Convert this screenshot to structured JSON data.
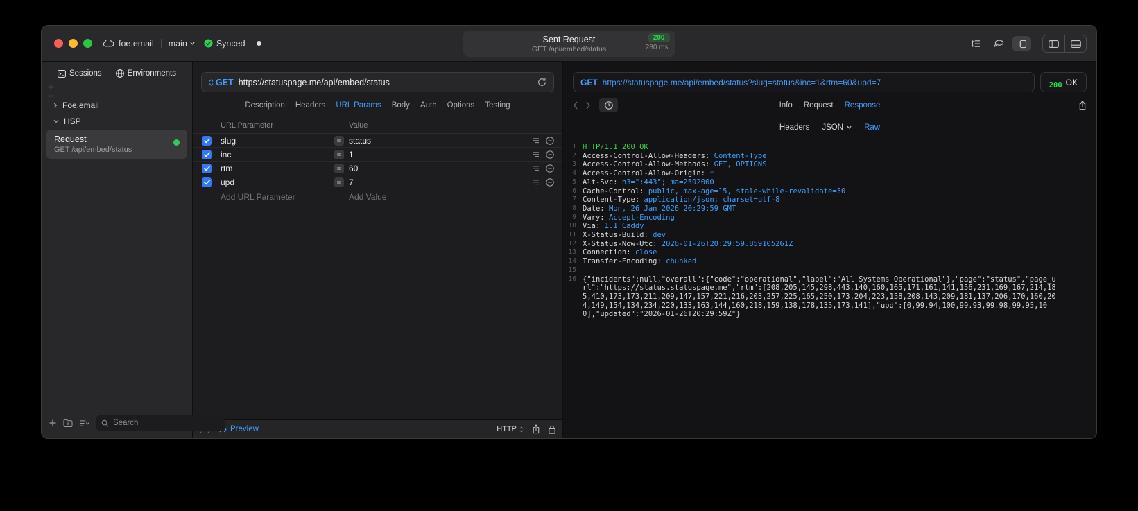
{
  "titlebar": {
    "project": "foe.email",
    "branch": "main",
    "sync_status": "Synced",
    "center": {
      "title": "Sent Request",
      "status_code": "200",
      "subtitle": "GET /api/embed/status",
      "duration": "280 ms"
    }
  },
  "sidebar": {
    "tabs": [
      {
        "label": "Sessions"
      },
      {
        "label": "Environments"
      }
    ],
    "tree": [
      {
        "label": "Foe.email"
      },
      {
        "label": "HSP"
      }
    ],
    "request_item": {
      "title": "Request",
      "subtitle": "GET /api/embed/status"
    },
    "search_placeholder": "Search"
  },
  "editor": {
    "method": "GET",
    "url_host": "https://statuspage.me",
    "url_path": "/api/embed/status",
    "tabs": [
      "Description",
      "Headers",
      "URL Params",
      "Body",
      "Auth",
      "Options",
      "Testing"
    ],
    "active_tab": "URL Params",
    "table": {
      "param_header": "URL Parameter",
      "value_header": "Value",
      "rows": [
        {
          "name": "slug",
          "value": "status",
          "enabled": true
        },
        {
          "name": "inc",
          "value": "1",
          "enabled": true
        },
        {
          "name": "rtm",
          "value": "60",
          "enabled": true
        },
        {
          "name": "upd",
          "value": "7",
          "enabled": true
        }
      ],
      "add_param": "Add URL Parameter",
      "add_value": "Add Value"
    },
    "footer": {
      "preview": "Preview",
      "protocol": "HTTP"
    }
  },
  "response": {
    "method": "GET",
    "url": "https://statuspage.me/api/embed/status?slug=status&inc=1&rtm=60&upd=7",
    "status_code": "200",
    "status_text": "OK",
    "tabs": [
      "Info",
      "Request",
      "Response"
    ],
    "active_tab": "Response",
    "view_tabs": [
      {
        "label": "Headers"
      },
      {
        "label": "JSON",
        "dropdown": true
      },
      {
        "label": "Raw"
      }
    ],
    "active_view": "Raw",
    "lines": [
      {
        "n": 1,
        "seg": [
          {
            "t": "HTTP/1.1 200 OK",
            "c": "status"
          }
        ]
      },
      {
        "n": 2,
        "seg": [
          {
            "t": "Access-Control-Allow-Headers: ",
            "c": "name"
          },
          {
            "t": "Content-Type",
            "c": "val"
          }
        ]
      },
      {
        "n": 3,
        "seg": [
          {
            "t": "Access-Control-Allow-Methods: ",
            "c": "name"
          },
          {
            "t": "GET, OPTIONS",
            "c": "val"
          }
        ]
      },
      {
        "n": 4,
        "seg": [
          {
            "t": "Access-Control-Allow-Origin: ",
            "c": "name"
          },
          {
            "t": "*",
            "c": "val"
          }
        ]
      },
      {
        "n": 5,
        "seg": [
          {
            "t": "Alt-Svc: ",
            "c": "name"
          },
          {
            "t": "h3=\":443\"; ma=2592000",
            "c": "val"
          }
        ]
      },
      {
        "n": 6,
        "seg": [
          {
            "t": "Cache-Control: ",
            "c": "name"
          },
          {
            "t": "public, max-age=15, stale-while-revalidate=30",
            "c": "val"
          }
        ]
      },
      {
        "n": 7,
        "seg": [
          {
            "t": "Content-Type: ",
            "c": "name"
          },
          {
            "t": "application/json; charset=utf-8",
            "c": "val"
          }
        ]
      },
      {
        "n": 8,
        "seg": [
          {
            "t": "Date: ",
            "c": "name"
          },
          {
            "t": "Mon, 26 Jan 2026 20:29:59 GMT",
            "c": "val"
          }
        ]
      },
      {
        "n": 9,
        "seg": [
          {
            "t": "Vary: ",
            "c": "name"
          },
          {
            "t": "Accept-Encoding",
            "c": "val"
          }
        ]
      },
      {
        "n": 10,
        "seg": [
          {
            "t": "Via: ",
            "c": "name"
          },
          {
            "t": "1.1 Caddy",
            "c": "val"
          }
        ]
      },
      {
        "n": 11,
        "seg": [
          {
            "t": "X-Status-Build: ",
            "c": "name"
          },
          {
            "t": "dev",
            "c": "val"
          }
        ]
      },
      {
        "n": 12,
        "seg": [
          {
            "t": "X-Status-Now-Utc: ",
            "c": "name"
          },
          {
            "t": "2026-01-26T20:29:59.859105261Z",
            "c": "val"
          }
        ]
      },
      {
        "n": 13,
        "seg": [
          {
            "t": "Connection: ",
            "c": "name"
          },
          {
            "t": "close",
            "c": "val"
          }
        ]
      },
      {
        "n": 14,
        "seg": [
          {
            "t": "Transfer-Encoding: ",
            "c": "name"
          },
          {
            "t": "chunked",
            "c": "val"
          }
        ]
      },
      {
        "n": 15,
        "seg": []
      },
      {
        "n": 16,
        "seg": [
          {
            "t": "{\"incidents\":null,\"overall\":{\"code\":\"operational\",\"label\":\"All Systems Operational\"},\"page\":\"status\",\"page_url\":\"https://status.statuspage.me\",\"rtm\":[208,205,145,298,443,140,160,165,171,161,141,156,231,169,167,214,185,410,173,173,211,209,147,157,221,216,203,257,225,165,250,173,204,223,158,208,143,209,181,137,206,170,160,204,149,154,134,234,220,133,163,144,160,218,159,138,178,135,173,141],\"upd\":[0,99.94,100,99.93,99.98,99.95,100],\"updated\":\"2026-01-26T20:29:59Z\"}",
            "c": "body"
          }
        ]
      }
    ]
  }
}
